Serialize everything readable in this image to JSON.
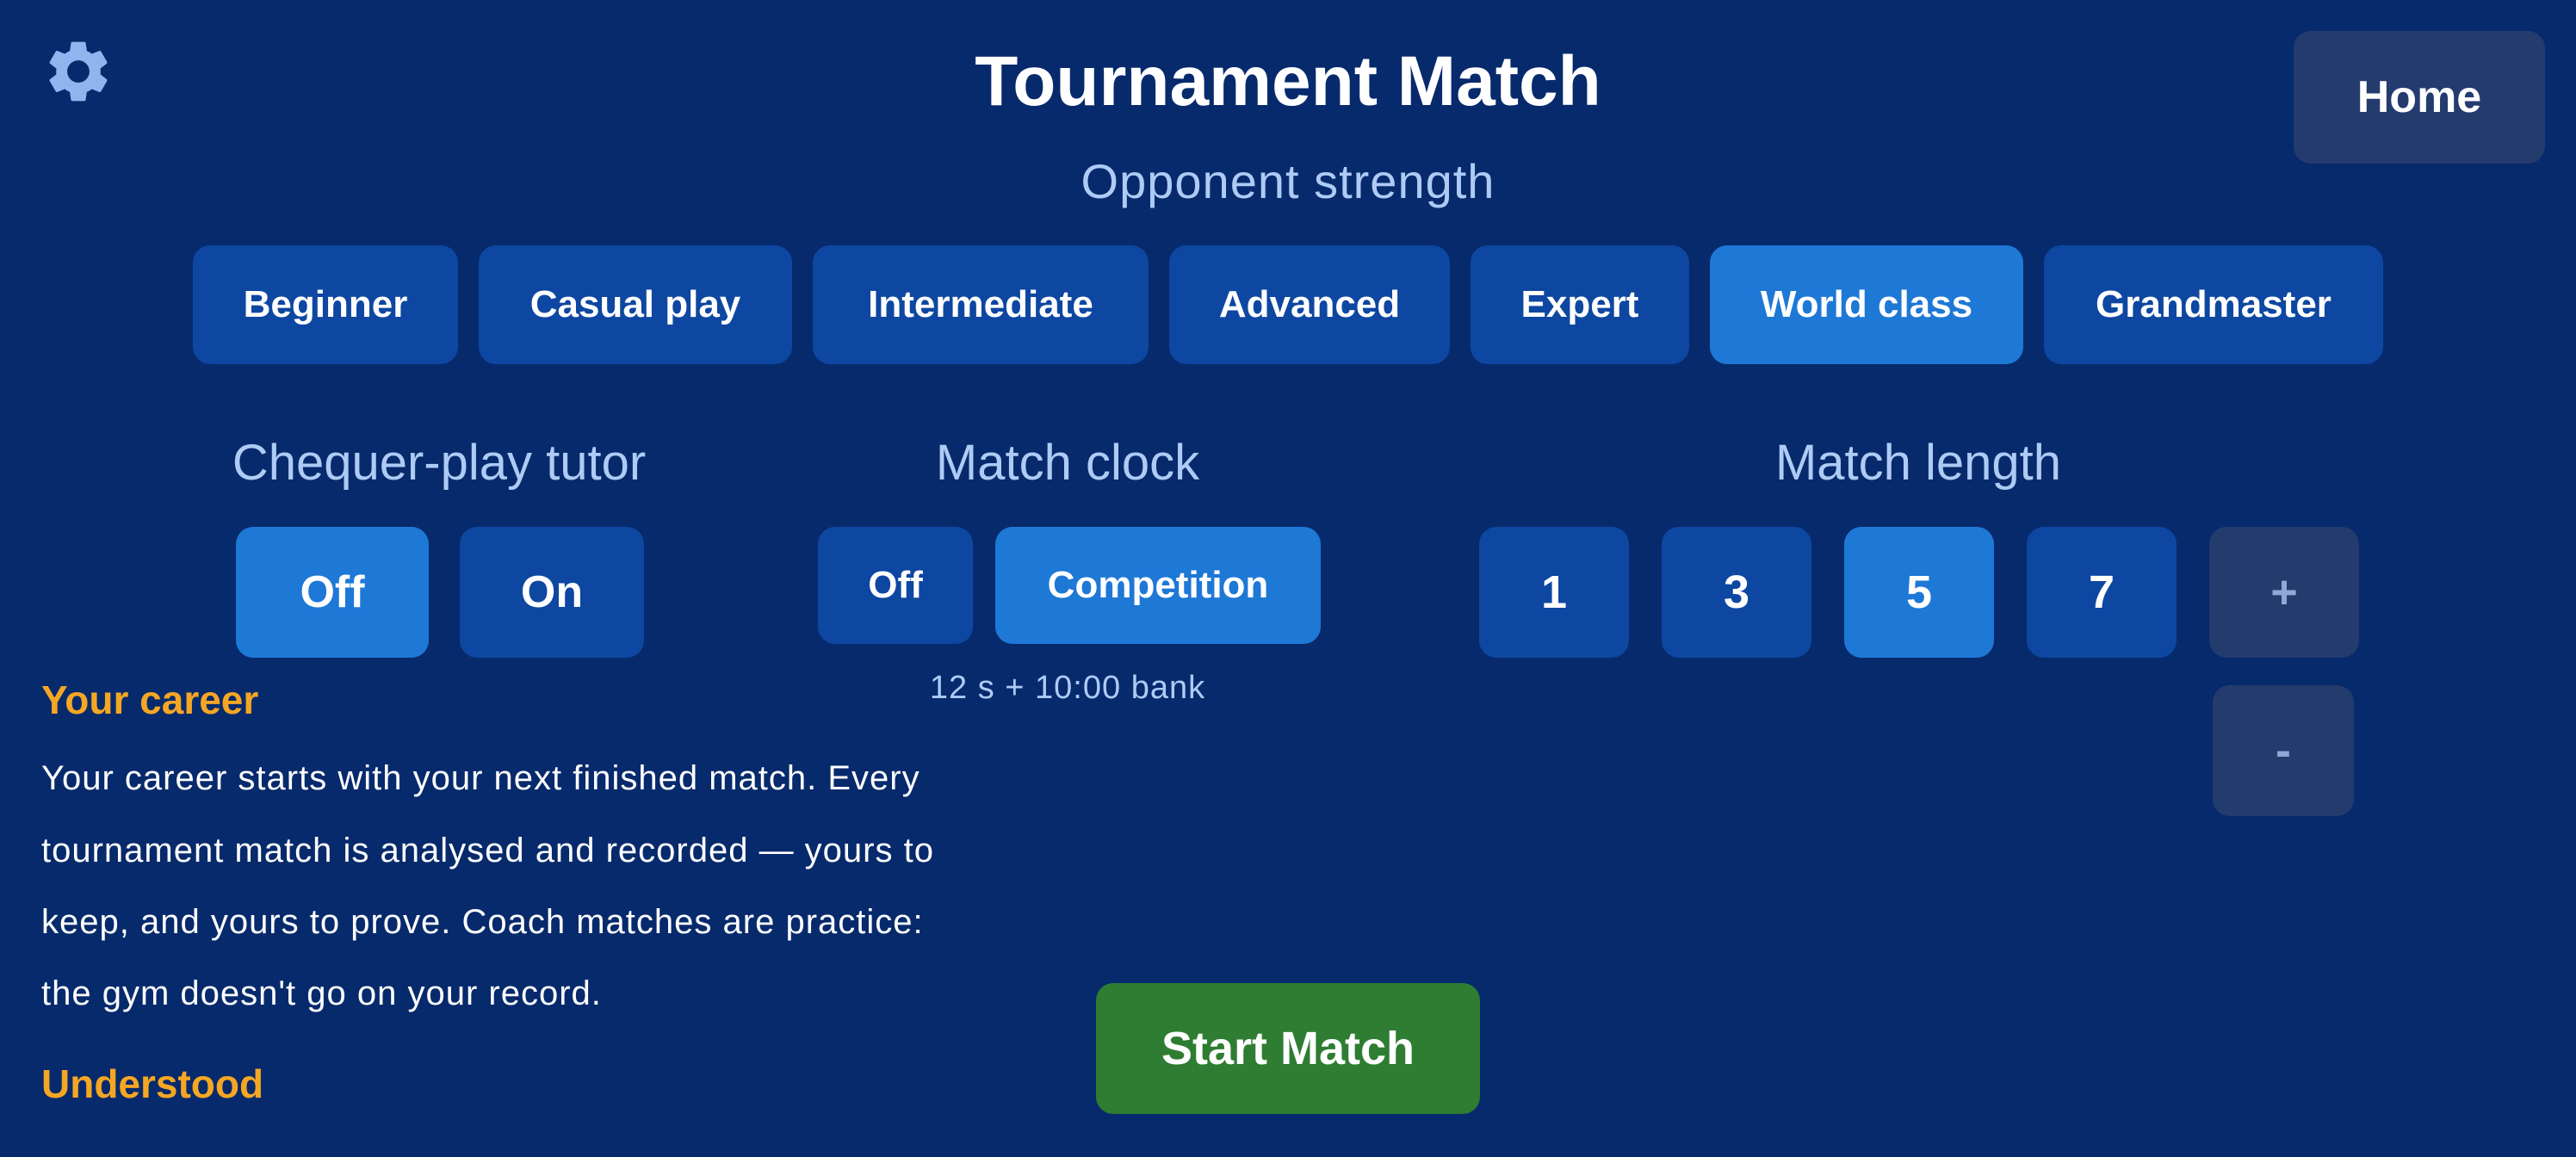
{
  "header": {
    "title": "Tournament Match",
    "home_label": "Home",
    "settings_icon": "gear-icon"
  },
  "opponent": {
    "label": "Opponent strength",
    "options": [
      "Beginner",
      "Casual play",
      "Intermediate",
      "Advanced",
      "Expert",
      "World class",
      "Grandmaster"
    ],
    "selected": "World class"
  },
  "tutor": {
    "label": "Chequer-play tutor",
    "options": [
      "Off",
      "On"
    ],
    "selected": "Off"
  },
  "clock": {
    "label": "Match clock",
    "options": [
      "Off",
      "Competition"
    ],
    "selected": "Competition",
    "description": "12 s + 10:00 bank"
  },
  "length": {
    "label": "Match length",
    "options": [
      "1",
      "3",
      "5",
      "7"
    ],
    "selected": "5",
    "increment_label": "+",
    "decrement_label": "-"
  },
  "career": {
    "title": "Your career",
    "lines": [
      "Your career starts with your next finished match. Every",
      "tournament match is analysed and recorded — yours to",
      "keep, and yours to prove. Coach matches are practice:",
      "the gym doesn't go on your record."
    ],
    "dismiss_label": "Understood"
  },
  "start_label": "Start Match",
  "colors": {
    "background": "#072a6c",
    "button": "#0d47a1",
    "button_selected": "#1e78d6",
    "button_disabled": "#243b6e",
    "accent": "#f5a623",
    "start": "#2e7d32",
    "label": "#aecbf5"
  }
}
